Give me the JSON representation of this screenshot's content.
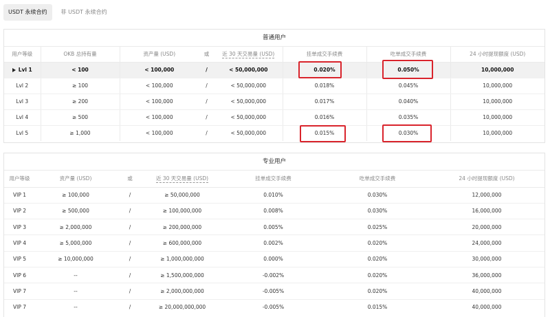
{
  "tabs": [
    {
      "label": "USDT 永续合约",
      "active": true
    },
    {
      "label": "非 USDT 永续合约",
      "active": false
    }
  ],
  "normal": {
    "title": "普通用户",
    "headers": [
      "用户等级",
      "OKB 总持有量",
      "资产量 (USD)",
      "或",
      "近 30 天交易量 (USD)",
      "挂单成交手续费",
      "吃单成交手续费",
      "24 小时提现额度 (USD)"
    ],
    "rows": [
      [
        "Lvl 1",
        "< 100",
        "< 100,000",
        "/",
        "< 50,000,000",
        "0.020%",
        "0.050%",
        "10,000,000"
      ],
      [
        "Lvl 2",
        "≥ 100",
        "< 100,000",
        "/",
        "< 50,000,000",
        "0.018%",
        "0.045%",
        "10,000,000"
      ],
      [
        "Lvl 3",
        "≥ 200",
        "< 100,000",
        "/",
        "< 50,000,000",
        "0.017%",
        "0.040%",
        "10,000,000"
      ],
      [
        "Lvl 4",
        "≥ 500",
        "< 100,000",
        "/",
        "< 50,000,000",
        "0.016%",
        "0.035%",
        "10,000,000"
      ],
      [
        "Lvl 5",
        "≥ 1,000",
        "< 100,000",
        "/",
        "< 50,000,000",
        "0.015%",
        "0.030%",
        "10,000,000"
      ]
    ]
  },
  "pro": {
    "title": "专业用户",
    "headers": [
      "用户等级",
      "资产量 (USD)",
      "或",
      "近 30 天交易量 (USD)",
      "挂单成交手续费",
      "吃单成交手续费",
      "24 小时提现额度 (USD)"
    ],
    "rows": [
      [
        "VIP 1",
        "≥ 100,000",
        "/",
        "≥ 50,000,000",
        "0.010%",
        "0.030%",
        "12,000,000"
      ],
      [
        "VIP 2",
        "≥ 500,000",
        "/",
        "≥ 100,000,000",
        "0.008%",
        "0.030%",
        "16,000,000"
      ],
      [
        "VIP 3",
        "≥ 2,000,000",
        "/",
        "≥ 200,000,000",
        "0.005%",
        "0.025%",
        "20,000,000"
      ],
      [
        "VIP 4",
        "≥ 5,000,000",
        "/",
        "≥ 600,000,000",
        "0.002%",
        "0.020%",
        "24,000,000"
      ],
      [
        "VIP 5",
        "≥ 10,000,000",
        "/",
        "≥ 1,000,000,000",
        "0.000%",
        "0.020%",
        "30,000,000"
      ],
      [
        "VIP 6",
        "--",
        "/",
        "≥ 1,500,000,000",
        "-0.002%",
        "0.020%",
        "36,000,000"
      ],
      [
        "VIP 7",
        "--",
        "/",
        "≥ 2,000,000,000",
        "-0.005%",
        "0.020%",
        "40,000,000"
      ],
      [
        "VIP 7",
        "--",
        "/",
        "≥ 20,000,000,000",
        "-0.005%",
        "0.015%",
        "40,000,000"
      ]
    ]
  },
  "colors": {
    "highlight": "#d9232b",
    "current_row_bg": "#f1f1f1"
  }
}
